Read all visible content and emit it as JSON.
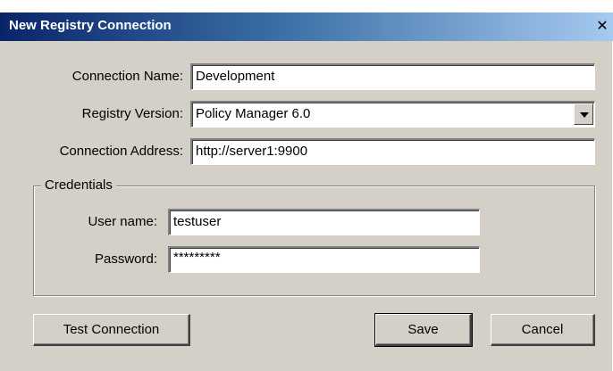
{
  "window": {
    "title": "New Registry Connection",
    "close_glyph": "✕"
  },
  "form": {
    "connection_name_label": "Connection Name:",
    "connection_name_value": "Development",
    "registry_version_label": "Registry Version:",
    "registry_version_value": "Policy Manager 6.0",
    "connection_address_label": "Connection Address:",
    "connection_address_value": "http://server1:9900"
  },
  "credentials": {
    "legend": "Credentials",
    "username_label": "User name:",
    "username_value": "testuser",
    "password_label": "Password:",
    "password_value": "*********"
  },
  "buttons": {
    "test_connection": "Test Connection",
    "save": "Save",
    "cancel": "Cancel"
  },
  "icons": {
    "close": "close-icon",
    "dropdown": "chevron-down-icon"
  },
  "colors": {
    "titlebar_start": "#0a246a",
    "titlebar_end": "#a6caf0",
    "dialog_background": "#d4d0c8"
  }
}
